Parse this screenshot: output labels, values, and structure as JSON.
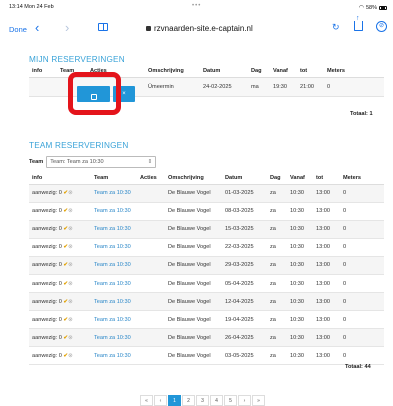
{
  "statusbar": {
    "time": "13:14",
    "date": "Mon 24 Feb",
    "dots": "•••",
    "battery": "58%"
  },
  "browser": {
    "done_label": "Done",
    "back_icon": "chevron-left-icon",
    "forward_icon": "chevron-right-icon",
    "url": "rzvnaarden-site.e-captain.nl"
  },
  "my_reservations": {
    "title": "MIJN RESERVERINGEN",
    "columns": [
      "info",
      "Team",
      "Acties",
      "Omschrijving",
      "Datum",
      "Dag",
      "Vanaf",
      "tot",
      "Meters"
    ],
    "rows": [
      {
        "info": "",
        "team": "",
        "omschrijving": "Ümeermin",
        "datum": "24-02-2025",
        "dag": "ma",
        "vanaf": "19:30",
        "tot": "21:00",
        "meters": "0"
      }
    ],
    "delete_label": "×",
    "total": "Totaal: 1"
  },
  "team_reservations": {
    "title": "TEAM RESERVERINGEN",
    "filter_label": "Team",
    "filter_value": "Team: Team za 10:30",
    "columns": [
      "info",
      "Team",
      "Acties",
      "Omschrijving",
      "Datum",
      "Dag",
      "Vanaf",
      "tot",
      "Meters"
    ],
    "rows": [
      {
        "info": "aanwezig: 0",
        "team": "Team za 10:30",
        "omschrijving": "De Blauwe Vogel",
        "datum": "01-03-2025",
        "dag": "za",
        "vanaf": "10:30",
        "tot": "13:00",
        "meters": "0"
      },
      {
        "info": "aanwezig: 0",
        "team": "Team za 10:30",
        "omschrijving": "De Blauwe Vogel",
        "datum": "08-03-2025",
        "dag": "za",
        "vanaf": "10:30",
        "tot": "13:00",
        "meters": "0"
      },
      {
        "info": "aanwezig: 0",
        "team": "Team za 10:30",
        "omschrijving": "De Blauwe Vogel",
        "datum": "15-03-2025",
        "dag": "za",
        "vanaf": "10:30",
        "tot": "13:00",
        "meters": "0"
      },
      {
        "info": "aanwezig: 0",
        "team": "Team za 10:30",
        "omschrijving": "De Blauwe Vogel",
        "datum": "22-03-2025",
        "dag": "za",
        "vanaf": "10:30",
        "tot": "13:00",
        "meters": "0"
      },
      {
        "info": "aanwezig: 0",
        "team": "Team za 10:30",
        "omschrijving": "De Blauwe Vogel",
        "datum": "29-03-2025",
        "dag": "za",
        "vanaf": "10:30",
        "tot": "13:00",
        "meters": "0"
      },
      {
        "info": "aanwezig: 0",
        "team": "Team za 10:30",
        "omschrijving": "De Blauwe Vogel",
        "datum": "05-04-2025",
        "dag": "za",
        "vanaf": "10:30",
        "tot": "13:00",
        "meters": "0"
      },
      {
        "info": "aanwezig: 0",
        "team": "Team za 10:30",
        "omschrijving": "De Blauwe Vogel",
        "datum": "12-04-2025",
        "dag": "za",
        "vanaf": "10:30",
        "tot": "13:00",
        "meters": "0"
      },
      {
        "info": "aanwezig: 0",
        "team": "Team za 10:30",
        "omschrijving": "De Blauwe Vogel",
        "datum": "19-04-2025",
        "dag": "za",
        "vanaf": "10:30",
        "tot": "13:00",
        "meters": "0"
      },
      {
        "info": "aanwezig: 0",
        "team": "Team za 10:30",
        "omschrijving": "De Blauwe Vogel",
        "datum": "26-04-2025",
        "dag": "za",
        "vanaf": "10:30",
        "tot": "13:00",
        "meters": "0"
      },
      {
        "info": "aanwezig: 0",
        "team": "Team za 10:30",
        "omschrijving": "De Blauwe Vogel",
        "datum": "03-05-2025",
        "dag": "za",
        "vanaf": "10:30",
        "tot": "13:00",
        "meters": "0"
      }
    ],
    "total": "Totaal: 44"
  },
  "pagination": [
    "«",
    "‹",
    "1",
    "2",
    "3",
    "4",
    "5",
    "›",
    "»"
  ],
  "pagination_active": "1",
  "colors": {
    "accent": "#2196d8",
    "heading": "#3aa3d8",
    "highlight": "#e4141b",
    "check": "#e2a40b"
  }
}
